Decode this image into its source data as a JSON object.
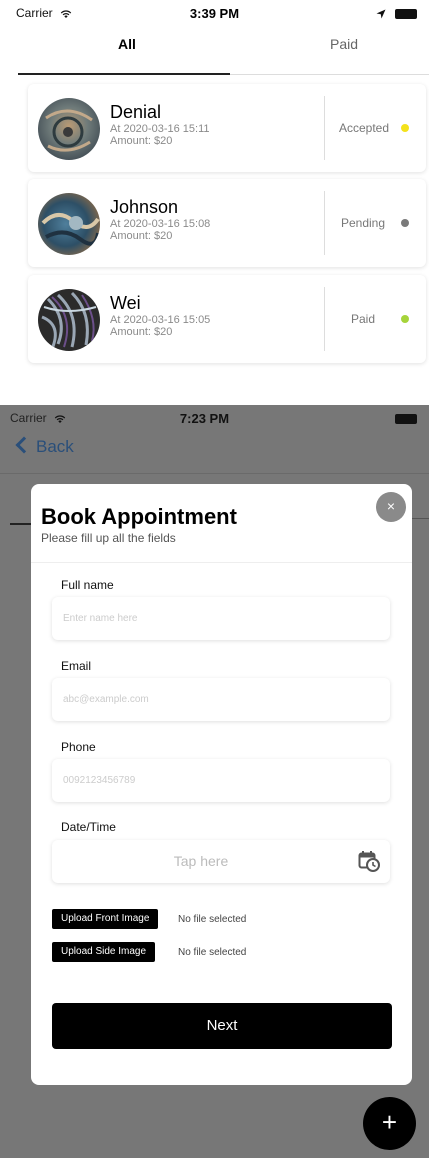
{
  "screen1": {
    "status": {
      "carrier": "Carrier",
      "time": "3:39 PM"
    },
    "tabs": [
      {
        "label": "All",
        "active": true
      },
      {
        "label": "Paid",
        "active": false
      }
    ],
    "appointments": [
      {
        "name": "Denial",
        "datetime": "At 2020-03-16 15:11",
        "amount": "Amount: $20",
        "status": "Accepted",
        "status_color": "#f4e21c",
        "avatar_icon": "artwork-avatar"
      },
      {
        "name": "Johnson",
        "datetime": "At 2020-03-16 15:08",
        "amount": "Amount: $20",
        "status": "Pending",
        "status_color": "#7a7a7a",
        "avatar_icon": "artwork-avatar"
      },
      {
        "name": "Wei",
        "datetime": "At 2020-03-16 15:05",
        "amount": "Amount: $20",
        "status": "Paid",
        "status_color": "#a6d43a",
        "avatar_icon": "artwork-avatar"
      }
    ]
  },
  "screen2": {
    "status": {
      "carrier": "Carrier",
      "time": "7:23 PM"
    },
    "nav": {
      "back_label": "Back"
    },
    "modal": {
      "title": "Book Appointment",
      "subtitle": "Please fill up all the fields",
      "close_symbol": "×",
      "fields": {
        "full_name": {
          "label": "Full name",
          "placeholder": "Enter name here",
          "value": ""
        },
        "email": {
          "label": "Email",
          "placeholder": "abc@example.com",
          "value": ""
        },
        "phone": {
          "label": "Phone",
          "placeholder": "0092123456789",
          "value": ""
        },
        "datetime": {
          "label": "Date/Time",
          "placeholder": "Tap here",
          "icon": "calendar-clock-icon"
        }
      },
      "uploads": {
        "front": {
          "button_label": "Upload Front Image",
          "status": "No file selected"
        },
        "side": {
          "button_label": "Upload Side Image",
          "status": "No file selected"
        }
      },
      "next_label": "Next"
    },
    "fab": {
      "symbol": "+"
    }
  },
  "colors": {
    "overlay": "#777777",
    "back_link": "#2a4f7a",
    "primary_button": "#000000"
  }
}
